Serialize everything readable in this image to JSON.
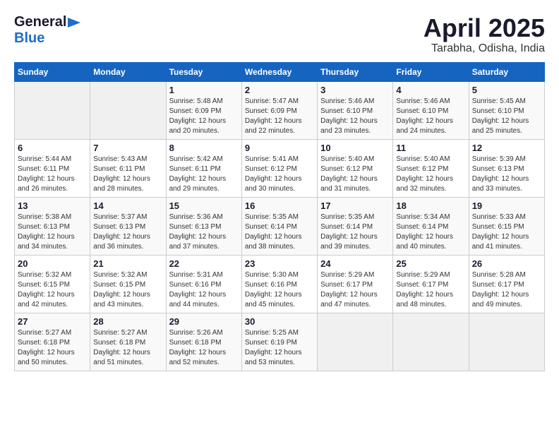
{
  "logo": {
    "general": "General",
    "blue": "Blue"
  },
  "title": "April 2025",
  "subtitle": "Tarabha, Odisha, India",
  "days_of_week": [
    "Sunday",
    "Monday",
    "Tuesday",
    "Wednesday",
    "Thursday",
    "Friday",
    "Saturday"
  ],
  "weeks": [
    [
      {
        "day": "",
        "info": ""
      },
      {
        "day": "",
        "info": ""
      },
      {
        "day": "1",
        "info": "Sunrise: 5:48 AM\nSunset: 6:09 PM\nDaylight: 12 hours\nand 20 minutes."
      },
      {
        "day": "2",
        "info": "Sunrise: 5:47 AM\nSunset: 6:09 PM\nDaylight: 12 hours\nand 22 minutes."
      },
      {
        "day": "3",
        "info": "Sunrise: 5:46 AM\nSunset: 6:10 PM\nDaylight: 12 hours\nand 23 minutes."
      },
      {
        "day": "4",
        "info": "Sunrise: 5:46 AM\nSunset: 6:10 PM\nDaylight: 12 hours\nand 24 minutes."
      },
      {
        "day": "5",
        "info": "Sunrise: 5:45 AM\nSunset: 6:10 PM\nDaylight: 12 hours\nand 25 minutes."
      }
    ],
    [
      {
        "day": "6",
        "info": "Sunrise: 5:44 AM\nSunset: 6:11 PM\nDaylight: 12 hours\nand 26 minutes."
      },
      {
        "day": "7",
        "info": "Sunrise: 5:43 AM\nSunset: 6:11 PM\nDaylight: 12 hours\nand 28 minutes."
      },
      {
        "day": "8",
        "info": "Sunrise: 5:42 AM\nSunset: 6:11 PM\nDaylight: 12 hours\nand 29 minutes."
      },
      {
        "day": "9",
        "info": "Sunrise: 5:41 AM\nSunset: 6:12 PM\nDaylight: 12 hours\nand 30 minutes."
      },
      {
        "day": "10",
        "info": "Sunrise: 5:40 AM\nSunset: 6:12 PM\nDaylight: 12 hours\nand 31 minutes."
      },
      {
        "day": "11",
        "info": "Sunrise: 5:40 AM\nSunset: 6:12 PM\nDaylight: 12 hours\nand 32 minutes."
      },
      {
        "day": "12",
        "info": "Sunrise: 5:39 AM\nSunset: 6:13 PM\nDaylight: 12 hours\nand 33 minutes."
      }
    ],
    [
      {
        "day": "13",
        "info": "Sunrise: 5:38 AM\nSunset: 6:13 PM\nDaylight: 12 hours\nand 34 minutes."
      },
      {
        "day": "14",
        "info": "Sunrise: 5:37 AM\nSunset: 6:13 PM\nDaylight: 12 hours\nand 36 minutes."
      },
      {
        "day": "15",
        "info": "Sunrise: 5:36 AM\nSunset: 6:13 PM\nDaylight: 12 hours\nand 37 minutes."
      },
      {
        "day": "16",
        "info": "Sunrise: 5:35 AM\nSunset: 6:14 PM\nDaylight: 12 hours\nand 38 minutes."
      },
      {
        "day": "17",
        "info": "Sunrise: 5:35 AM\nSunset: 6:14 PM\nDaylight: 12 hours\nand 39 minutes."
      },
      {
        "day": "18",
        "info": "Sunrise: 5:34 AM\nSunset: 6:14 PM\nDaylight: 12 hours\nand 40 minutes."
      },
      {
        "day": "19",
        "info": "Sunrise: 5:33 AM\nSunset: 6:15 PM\nDaylight: 12 hours\nand 41 minutes."
      }
    ],
    [
      {
        "day": "20",
        "info": "Sunrise: 5:32 AM\nSunset: 6:15 PM\nDaylight: 12 hours\nand 42 minutes."
      },
      {
        "day": "21",
        "info": "Sunrise: 5:32 AM\nSunset: 6:15 PM\nDaylight: 12 hours\nand 43 minutes."
      },
      {
        "day": "22",
        "info": "Sunrise: 5:31 AM\nSunset: 6:16 PM\nDaylight: 12 hours\nand 44 minutes."
      },
      {
        "day": "23",
        "info": "Sunrise: 5:30 AM\nSunset: 6:16 PM\nDaylight: 12 hours\nand 45 minutes."
      },
      {
        "day": "24",
        "info": "Sunrise: 5:29 AM\nSunset: 6:17 PM\nDaylight: 12 hours\nand 47 minutes."
      },
      {
        "day": "25",
        "info": "Sunrise: 5:29 AM\nSunset: 6:17 PM\nDaylight: 12 hours\nand 48 minutes."
      },
      {
        "day": "26",
        "info": "Sunrise: 5:28 AM\nSunset: 6:17 PM\nDaylight: 12 hours\nand 49 minutes."
      }
    ],
    [
      {
        "day": "27",
        "info": "Sunrise: 5:27 AM\nSunset: 6:18 PM\nDaylight: 12 hours\nand 50 minutes."
      },
      {
        "day": "28",
        "info": "Sunrise: 5:27 AM\nSunset: 6:18 PM\nDaylight: 12 hours\nand 51 minutes."
      },
      {
        "day": "29",
        "info": "Sunrise: 5:26 AM\nSunset: 6:18 PM\nDaylight: 12 hours\nand 52 minutes."
      },
      {
        "day": "30",
        "info": "Sunrise: 5:25 AM\nSunset: 6:19 PM\nDaylight: 12 hours\nand 53 minutes."
      },
      {
        "day": "",
        "info": ""
      },
      {
        "day": "",
        "info": ""
      },
      {
        "day": "",
        "info": ""
      }
    ]
  ]
}
